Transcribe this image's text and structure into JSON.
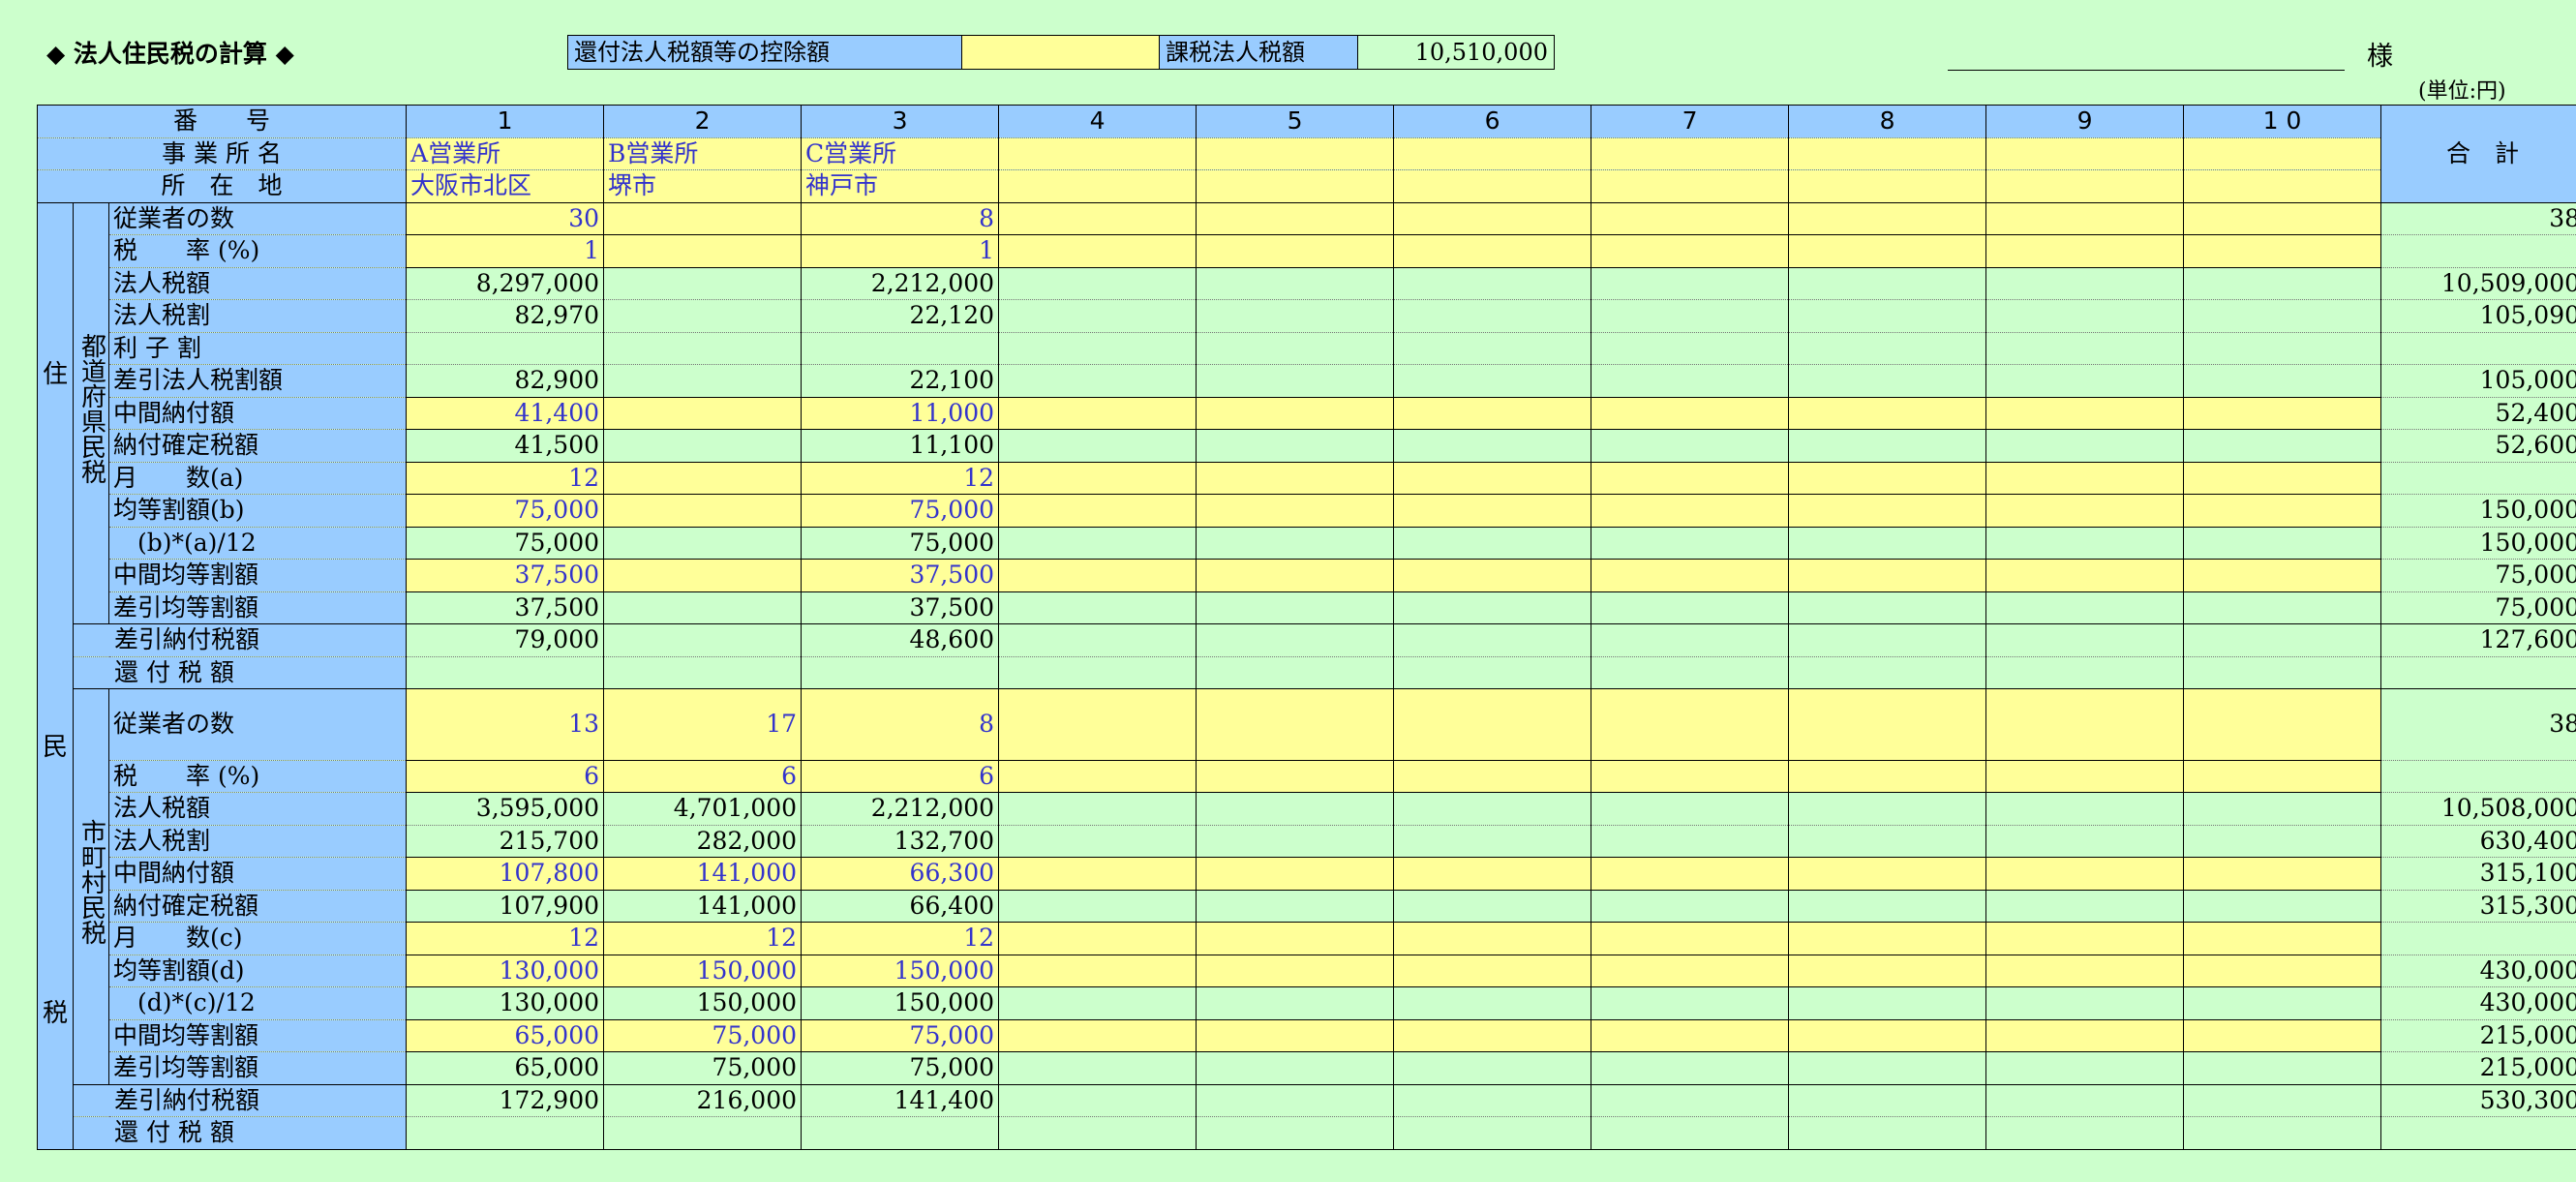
{
  "header": {
    "title": "◆ 法人住民税の計算 ◆",
    "refund_deduction_label": "還付法人税額等の控除額",
    "refund_deduction_value": "",
    "taxable_label": "課税法人税額",
    "taxable_value": "10,510,000",
    "name_value": "",
    "sama": "様",
    "unit": "(単位:円)"
  },
  "columns": {
    "number_label": "番　　号",
    "office_label": "事 業 所 名",
    "location_label": "所　在　地",
    "total_label": "合　計",
    "numbers": [
      "1",
      "2",
      "3",
      "4",
      "5",
      "6",
      "7",
      "8",
      "9",
      "1 0"
    ],
    "offices": [
      "A営業所",
      "B営業所",
      "C営業所",
      "",
      "",
      "",
      "",
      "",
      "",
      ""
    ],
    "locations": [
      "大阪市北区",
      "堺市",
      "神戸市",
      "",
      "",
      "",
      "",
      "",
      "",
      ""
    ]
  },
  "side": {
    "jumin": "住",
    "min": "民",
    "zei": "税",
    "pref": "都道府県民税",
    "city": "市町村民税"
  },
  "pref_rows": [
    {
      "label": "従業者の数",
      "values": [
        "30",
        "",
        "8",
        "",
        "",
        "",
        "",
        "",
        "",
        ""
      ],
      "total": "38",
      "input": true
    },
    {
      "label": "税　　率 (%)",
      "values": [
        "1",
        "",
        "1",
        "",
        "",
        "",
        "",
        "",
        "",
        ""
      ],
      "total": "",
      "input": true
    },
    {
      "label": "法人税額",
      "values": [
        "8,297,000",
        "",
        "2,212,000",
        "",
        "",
        "",
        "",
        "",
        "",
        ""
      ],
      "total": "10,509,000",
      "input": false
    },
    {
      "label": "法人税割",
      "values": [
        "82,970",
        "",
        "22,120",
        "",
        "",
        "",
        "",
        "",
        "",
        ""
      ],
      "total": "105,090",
      "input": false
    },
    {
      "label": "利 子 割",
      "values": [
        "",
        "",
        "",
        "",
        "",
        "",
        "",
        "",
        "",
        ""
      ],
      "total": "",
      "input": false
    },
    {
      "label": "差引法人税割額",
      "values": [
        "82,900",
        "",
        "22,100",
        "",
        "",
        "",
        "",
        "",
        "",
        ""
      ],
      "total": "105,000",
      "input": false
    },
    {
      "label": "中間納付額",
      "values": [
        "41,400",
        "",
        "11,000",
        "",
        "",
        "",
        "",
        "",
        "",
        ""
      ],
      "total": "52,400",
      "input": true
    },
    {
      "label": "納付確定税額",
      "values": [
        "41,500",
        "",
        "11,100",
        "",
        "",
        "",
        "",
        "",
        "",
        ""
      ],
      "total": "52,600",
      "input": false
    },
    {
      "label": "月　　数(a)",
      "values": [
        "12",
        "",
        "12",
        "",
        "",
        "",
        "",
        "",
        "",
        ""
      ],
      "total": "",
      "input": true
    },
    {
      "label": "均等割額(b)",
      "values": [
        "75,000",
        "",
        "75,000",
        "",
        "",
        "",
        "",
        "",
        "",
        ""
      ],
      "total": "150,000",
      "input": true
    },
    {
      "label": "　(b)*(a)/12",
      "values": [
        "75,000",
        "",
        "75,000",
        "",
        "",
        "",
        "",
        "",
        "",
        ""
      ],
      "total": "150,000",
      "input": false
    },
    {
      "label": "中間均等割額",
      "values": [
        "37,500",
        "",
        "37,500",
        "",
        "",
        "",
        "",
        "",
        "",
        ""
      ],
      "total": "75,000",
      "input": true
    },
    {
      "label": "差引均等割額",
      "values": [
        "37,500",
        "",
        "37,500",
        "",
        "",
        "",
        "",
        "",
        "",
        ""
      ],
      "total": "75,000",
      "input": false
    }
  ],
  "pref_summary": [
    {
      "label": "差引納付税額",
      "values": [
        "79,000",
        "",
        "48,600",
        "",
        "",
        "",
        "",
        "",
        "",
        ""
      ],
      "total": "127,600"
    },
    {
      "label": "還 付 税 額",
      "values": [
        "",
        "",
        "",
        "",
        "",
        "",
        "",
        "",
        "",
        ""
      ],
      "total": ""
    }
  ],
  "city_rows": [
    {
      "label": "従業者の数",
      "values": [
        "13",
        "17",
        "8",
        "",
        "",
        "",
        "",
        "",
        "",
        ""
      ],
      "total": "38",
      "input": true
    },
    {
      "label": "税　　率 (%)",
      "values": [
        "6",
        "6",
        "6",
        "",
        "",
        "",
        "",
        "",
        "",
        ""
      ],
      "total": "",
      "input": true
    },
    {
      "label": "法人税額",
      "values": [
        "3,595,000",
        "4,701,000",
        "2,212,000",
        "",
        "",
        "",
        "",
        "",
        "",
        ""
      ],
      "total": "10,508,000",
      "input": false
    },
    {
      "label": "法人税割",
      "values": [
        "215,700",
        "282,000",
        "132,700",
        "",
        "",
        "",
        "",
        "",
        "",
        ""
      ],
      "total": "630,400",
      "input": false
    },
    {
      "label": "中間納付額",
      "values": [
        "107,800",
        "141,000",
        "66,300",
        "",
        "",
        "",
        "",
        "",
        "",
        ""
      ],
      "total": "315,100",
      "input": true
    },
    {
      "label": "納付確定税額",
      "values": [
        "107,900",
        "141,000",
        "66,400",
        "",
        "",
        "",
        "",
        "",
        "",
        ""
      ],
      "total": "315,300",
      "input": false
    },
    {
      "label": "月　　数(c)",
      "values": [
        "12",
        "12",
        "12",
        "",
        "",
        "",
        "",
        "",
        "",
        ""
      ],
      "total": "",
      "input": true
    },
    {
      "label": "均等割額(d)",
      "values": [
        "130,000",
        "150,000",
        "150,000",
        "",
        "",
        "",
        "",
        "",
        "",
        ""
      ],
      "total": "430,000",
      "input": true
    },
    {
      "label": "　(d)*(c)/12",
      "values": [
        "130,000",
        "150,000",
        "150,000",
        "",
        "",
        "",
        "",
        "",
        "",
        ""
      ],
      "total": "430,000",
      "input": false
    },
    {
      "label": "中間均等割額",
      "values": [
        "65,000",
        "75,000",
        "75,000",
        "",
        "",
        "",
        "",
        "",
        "",
        ""
      ],
      "total": "215,000",
      "input": true
    },
    {
      "label": "差引均等割額",
      "values": [
        "65,000",
        "75,000",
        "75,000",
        "",
        "",
        "",
        "",
        "",
        "",
        ""
      ],
      "total": "215,000",
      "input": false
    }
  ],
  "city_summary": [
    {
      "label": "差引納付税額",
      "values": [
        "172,900",
        "216,000",
        "141,400",
        "",
        "",
        "",
        "",
        "",
        "",
        ""
      ],
      "total": "530,300"
    },
    {
      "label": "還 付 税 額",
      "values": [
        "",
        "",
        "",
        "",
        "",
        "",
        "",
        "",
        "",
        ""
      ],
      "total": ""
    }
  ],
  "colors": {
    "background": "#ccffcc",
    "header_blue": "#99ccff",
    "input_yellow": "#ffff99",
    "input_text": "#3333cc"
  }
}
